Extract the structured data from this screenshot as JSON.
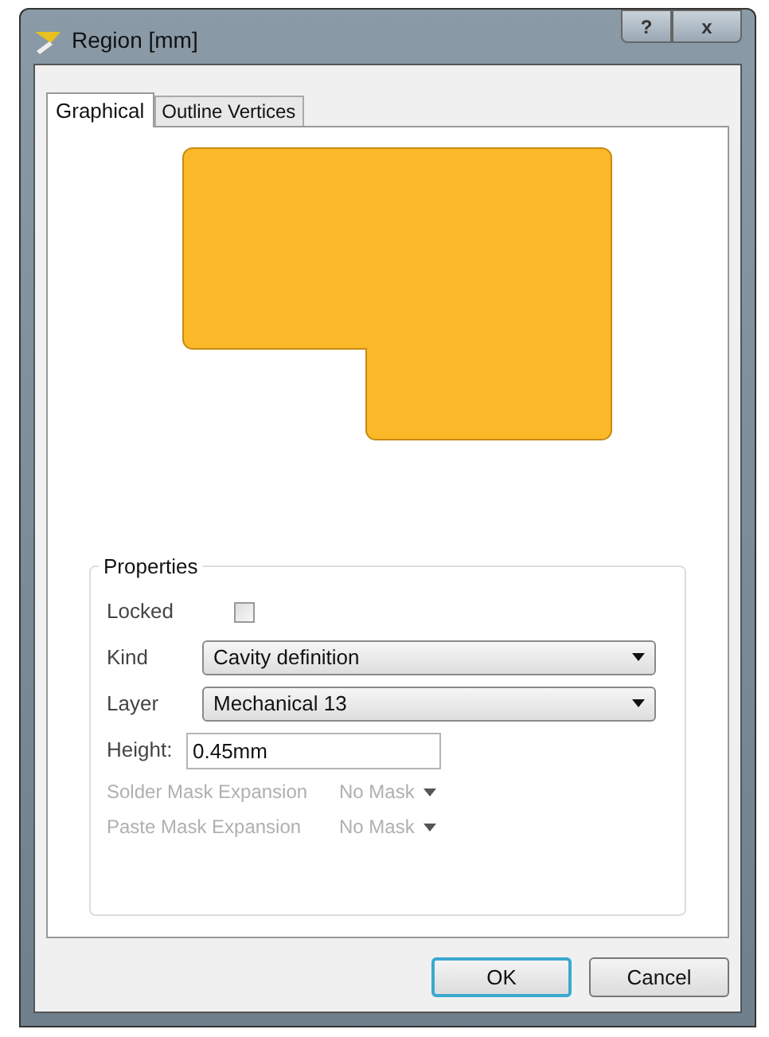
{
  "window": {
    "title": "Region [mm]",
    "help": "?",
    "close": "x"
  },
  "tabs": [
    {
      "label": "Graphical",
      "selected": true
    },
    {
      "label": "Outline Vertices",
      "selected": false
    }
  ],
  "properties": {
    "title": "Properties",
    "rows": [
      {
        "kind": "checkbox",
        "label": "Locked",
        "checked": false,
        "disabled": false
      },
      {
        "kind": "select",
        "label": "Kind",
        "value": "Cavity definition",
        "disabled": false
      },
      {
        "kind": "select",
        "label": "Layer",
        "value": "Mechanical 13",
        "disabled": false
      },
      {
        "kind": "input",
        "label": "Height:",
        "value": "0.45mm",
        "disabled": false
      },
      {
        "kind": "mini-select",
        "label": "Solder Mask Expansion",
        "value": "No Mask",
        "disabled": true
      },
      {
        "kind": "mini-select",
        "label": "Paste Mask Expansion",
        "value": "No Mask",
        "disabled": true
      }
    ]
  },
  "buttons": [
    {
      "label": "OK",
      "default": true
    },
    {
      "label": "Cancel",
      "default": false
    }
  ]
}
